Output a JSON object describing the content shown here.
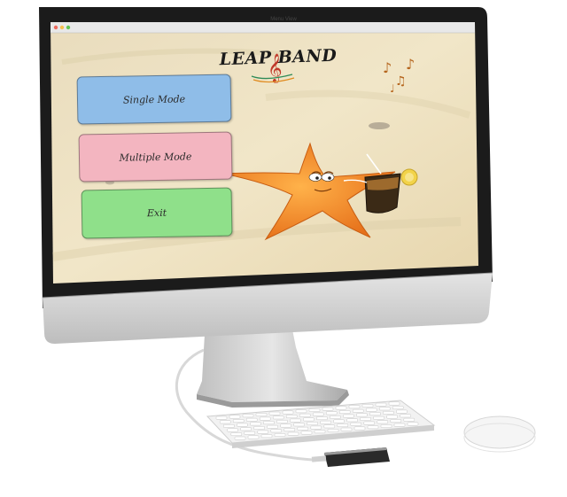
{
  "window": {
    "title": "Menu View"
  },
  "logo": {
    "text": "LEAP BAND"
  },
  "menu": {
    "single_mode": "Single Mode",
    "multiple_mode": "Multiple Mode",
    "exit": "Exit"
  },
  "colors": {
    "single_mode_button": "#8fbde8",
    "multiple_mode_button": "#f3b5c0",
    "exit_button": "#8fe08a",
    "sand": "#ece2c3",
    "starfish": "#f08a1e"
  }
}
